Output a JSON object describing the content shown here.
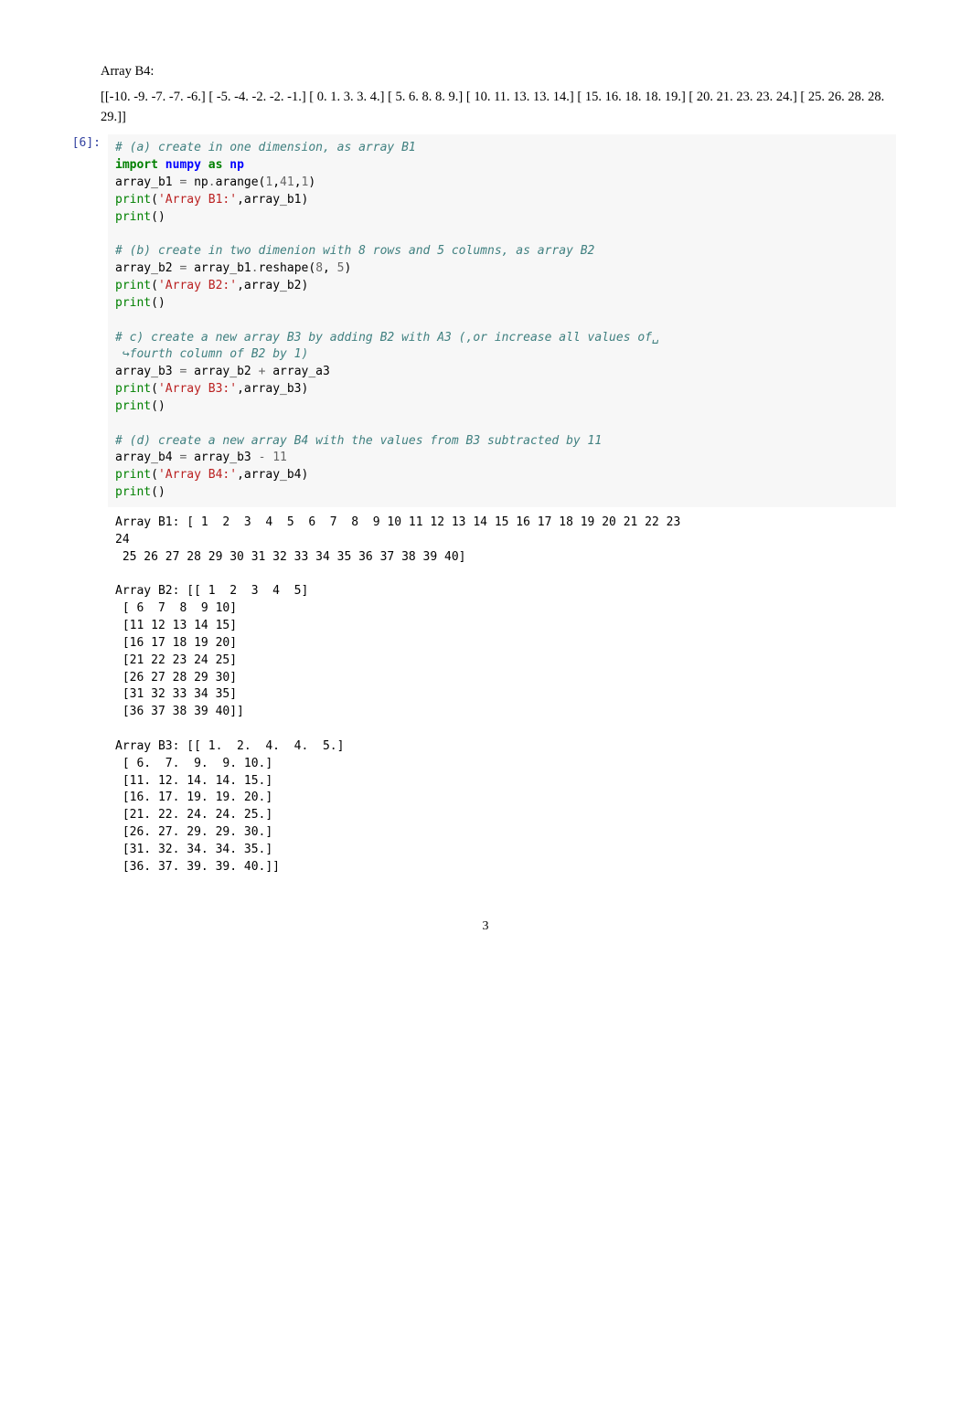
{
  "prose": {
    "heading": "Array B4:",
    "para": "[[-10. -9. -7. -7. -6.] [ -5. -4. -2. -2. -1.] [ 0. 1. 3. 3. 4.] [ 5. 6. 8. 8. 9.] [ 10. 11. 13. 13. 14.] [ 15. 16. 18. 18. 19.] [ 20. 21. 23. 23. 24.] [ 25. 26. 28. 28. 29.]]"
  },
  "cell": {
    "prompt": "[6]:",
    "code": {
      "l1": "# (a) create in one dimension, as array B1",
      "l2a": "import",
      "l2b": "numpy",
      "l2c": "as",
      "l2d": "np",
      "l3a": "array_b1 ",
      "l3b": "=",
      "l3c": " np",
      "l3d": ".",
      "l3e": "arange(",
      "l3f": "1",
      "l3g": ",",
      "l3h": "41",
      "l3i": ",",
      "l3j": "1",
      "l3k": ")",
      "l4a": "print",
      "l4b": "(",
      "l4c": "'Array B1:'",
      "l4d": ",array_b1)",
      "l5a": "print",
      "l5b": "()",
      "l6": "# (b) create in two dimenion with 8 rows and 5 columns, as array B2",
      "l7a": "array_b2 ",
      "l7b": "=",
      "l7c": " array_b1",
      "l7d": ".",
      "l7e": "reshape(",
      "l7f": "8",
      "l7g": ", ",
      "l7h": "5",
      "l7i": ")",
      "l8a": "print",
      "l8b": "(",
      "l8c": "'Array B2:'",
      "l8d": ",array_b2)",
      "l9a": "print",
      "l9b": "()",
      "l10a": "# c) create a new array B3 by adding B2 with A3 (,or increase all values of",
      "l10b": "␣",
      "l11a": " ",
      "l11b": "↪",
      "l11c": "fourth column of B2 by 1)",
      "l12a": "array_b3 ",
      "l12b": "=",
      "l12c": " array_b2 ",
      "l12d": "+",
      "l12e": " array_a3",
      "l13a": "print",
      "l13b": "(",
      "l13c": "'Array B3:'",
      "l13d": ",array_b3)",
      "l14a": "print",
      "l14b": "()",
      "l15": "# (d) create a new array B4 with the values from B3 subtracted by 11",
      "l16a": "array_b4 ",
      "l16b": "=",
      "l16c": " array_b3 ",
      "l16d": "-",
      "l16e": " ",
      "l16f": "11",
      "l17a": "print",
      "l17b": "(",
      "l17c": "'Array B4:'",
      "l17d": ",array_b4)",
      "l18a": "print",
      "l18b": "()"
    }
  },
  "output": "Array B1: [ 1  2  3  4  5  6  7  8  9 10 11 12 13 14 15 16 17 18 19 20 21 22 23\n24\n 25 26 27 28 29 30 31 32 33 34 35 36 37 38 39 40]\n\nArray B2: [[ 1  2  3  4  5]\n [ 6  7  8  9 10]\n [11 12 13 14 15]\n [16 17 18 19 20]\n [21 22 23 24 25]\n [26 27 28 29 30]\n [31 32 33 34 35]\n [36 37 38 39 40]]\n\nArray B3: [[ 1.  2.  4.  4.  5.]\n [ 6.  7.  9.  9. 10.]\n [11. 12. 14. 14. 15.]\n [16. 17. 19. 19. 20.]\n [21. 22. 24. 24. 25.]\n [26. 27. 29. 29. 30.]\n [31. 32. 34. 34. 35.]\n [36. 37. 39. 39. 40.]]",
  "page_number": "3"
}
